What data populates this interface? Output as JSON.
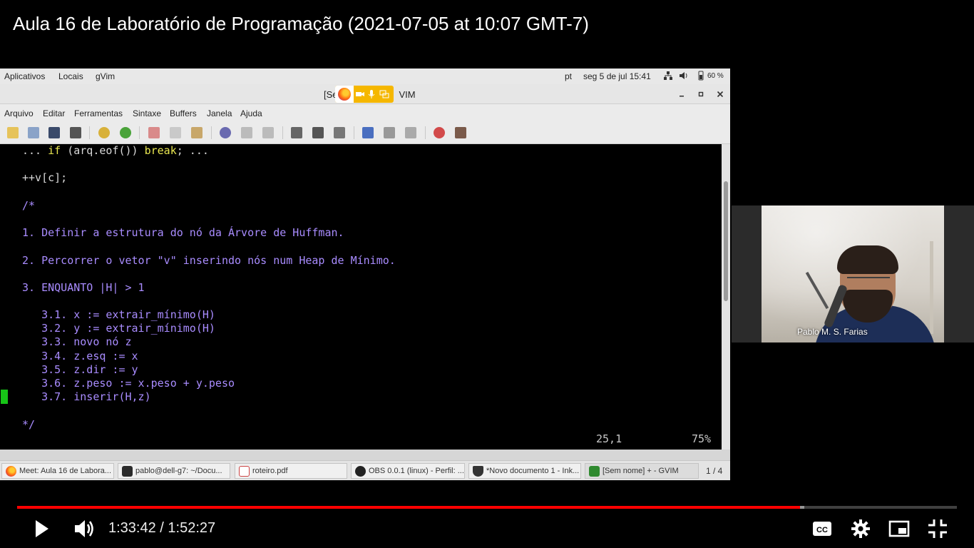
{
  "video": {
    "title": "Aula 16 de Laboratório de Programação (2021-07-05 at 10:07 GMT-7)",
    "current_time": "1:33:42",
    "duration": "1:52:27",
    "time_display": "1:33:42 / 1:52:27",
    "progress_fraction": 0.833,
    "buffered_fraction": 0.838,
    "accent_color": "#ff0000"
  },
  "top_panel": {
    "menus": [
      "Aplicativos",
      "Locais",
      "gVim"
    ],
    "keyboard_layout": "pt",
    "clock": "seg 5 de jul  15:41",
    "battery": "60 %",
    "icons": [
      "network-icon",
      "volume-icon",
      "battery-icon"
    ]
  },
  "window": {
    "title_left": "[Se",
    "title_right": "VIM",
    "share_indicator_icons": [
      "firefox-icon",
      "camera-icon",
      "microphone-icon",
      "screen-share-icon"
    ],
    "share_indicator_color": "#f5b700"
  },
  "menubar": {
    "items": [
      "Arquivo",
      "Editar",
      "Ferramentas",
      "Sintaxe",
      "Buffers",
      "Janela",
      "Ajuda"
    ]
  },
  "toolbar": {
    "icons": [
      "open-icon",
      "save-all-icon",
      "save-icon",
      "print-icon",
      "undo-icon",
      "redo-icon",
      "cut-icon",
      "copy-icon",
      "paste-icon",
      "find-replace-icon",
      "find-next-icon",
      "find-prev-icon",
      "load-session-icon",
      "save-session-icon",
      "run-script-icon",
      "make-icon",
      "shell-icon",
      "tags-icon",
      "help-icon",
      "find-help-icon"
    ]
  },
  "editor": {
    "lines": {
      "l1_pre": "... ",
      "l1_kw1": "if",
      "l1_mid": " (arq.eof()) ",
      "l1_kw2": "break",
      "l1_post": "; ...",
      "l2": "++v[c];",
      "l3": "/*",
      "l4": "1. Definir a estrutura do nó da Árvore de Huffman.",
      "l5": "2. Percorrer o vetor \"v\" inserindo nós num Heap de Mínimo.",
      "l6": "3. ENQUANTO |H| > 1",
      "l7": "   3.1. x := extrair_mínimo(H)",
      "l8": "   3.2. y := extrair_mínimo(H)",
      "l9": "   3.3. novo nó z",
      "l10": "   3.4. z.esq := x",
      "l11": "   3.5. z.dir := y",
      "l12": "   3.6. z.peso := x.peso + y.peso",
      "l13": "   3.7. inserir(H,z)",
      "l14": "*/"
    },
    "cursor_position": "25,1",
    "scroll_percent": "75%",
    "comment_color": "#a98cff",
    "keyword_color": "#e8e650"
  },
  "taskbar": {
    "tasks": [
      {
        "label": "Meet: Aula 16 de Labora...",
        "icon": "firefox-icon"
      },
      {
        "label": "pablo@dell-g7: ~/Docu...",
        "icon": "terminal-icon"
      },
      {
        "label": "roteiro.pdf",
        "icon": "pdf-icon"
      },
      {
        "label": "OBS 0.0.1 (linux) - Perfil: ...",
        "icon": "obs-icon"
      },
      {
        "label": "*Novo documento 1 - Ink...",
        "icon": "inkscape-icon"
      },
      {
        "label": "[Sem nome] + - GVIM",
        "icon": "gvim-icon"
      }
    ],
    "workspace": "1 / 4"
  },
  "webcam": {
    "participant_name": "Pablo M. S. Farias"
  },
  "controls": {
    "icons": [
      "play-icon",
      "volume-icon",
      "captions-icon",
      "settings-icon",
      "miniplayer-icon",
      "exit-fullscreen-icon"
    ]
  }
}
